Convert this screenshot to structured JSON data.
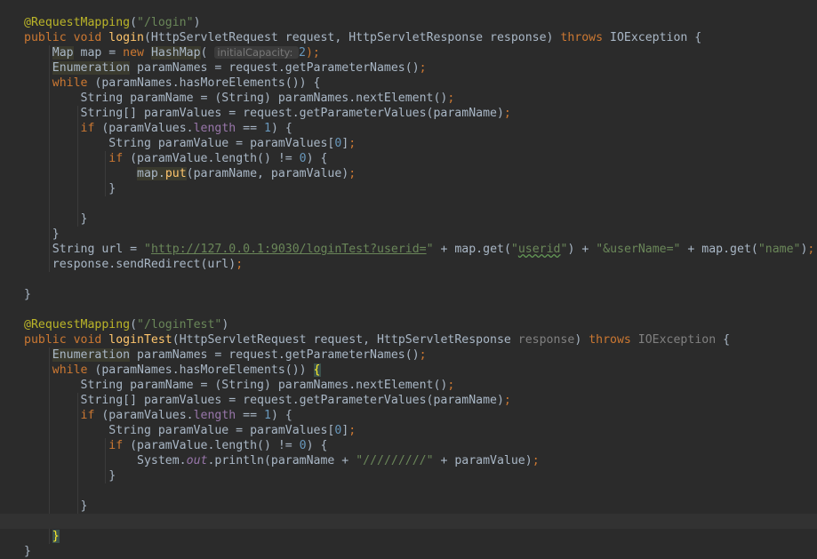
{
  "editor": {
    "lines": [
      {
        "tokens": [
          {
            "t": "@RequestMapping",
            "c": "ann"
          },
          {
            "t": "(",
            "c": "text"
          },
          {
            "t": "\"/login\"",
            "c": "str"
          },
          {
            "t": ")",
            "c": "text"
          }
        ]
      },
      {
        "tokens": [
          {
            "t": "public void ",
            "c": "kw"
          },
          {
            "t": "login",
            "c": "fn"
          },
          {
            "t": "(HttpServletRequest request, HttpServletResponse response) ",
            "c": "text"
          },
          {
            "t": "throws ",
            "c": "kw"
          },
          {
            "t": "IOException {",
            "c": "text"
          }
        ]
      },
      {
        "tokens": [
          {
            "t": "    ",
            "c": "text"
          },
          {
            "t": "Map",
            "c": "warn"
          },
          {
            "t": " map = ",
            "c": "text"
          },
          {
            "t": "new ",
            "c": "kw"
          },
          {
            "t": "HashMap",
            "c": "warn"
          },
          {
            "t": "( ",
            "c": "text"
          },
          {
            "t": "initialCapacity: ",
            "c": "hint"
          },
          {
            "t": "2",
            "c": "num"
          },
          {
            "t": ");",
            "c": "kw"
          }
        ]
      },
      {
        "tokens": [
          {
            "t": "    ",
            "c": "text"
          },
          {
            "t": "Enumeration",
            "c": "warn"
          },
          {
            "t": " paramNames = request.getParameterNames()",
            "c": "text"
          },
          {
            "t": ";",
            "c": "kw"
          }
        ]
      },
      {
        "tokens": [
          {
            "t": "    ",
            "c": "text"
          },
          {
            "t": "while ",
            "c": "kw"
          },
          {
            "t": "(paramNames.hasMoreElements()) {",
            "c": "text"
          }
        ]
      },
      {
        "tokens": [
          {
            "t": "        String paramName = (String) paramNames.nextElement()",
            "c": "text"
          },
          {
            "t": ";",
            "c": "kw"
          }
        ]
      },
      {
        "tokens": [
          {
            "t": "        String[] paramValues = request.getParameterValues(paramName)",
            "c": "text"
          },
          {
            "t": ";",
            "c": "kw"
          }
        ]
      },
      {
        "tokens": [
          {
            "t": "        ",
            "c": "text"
          },
          {
            "t": "if ",
            "c": "kw"
          },
          {
            "t": "(paramValues.",
            "c": "text"
          },
          {
            "t": "length ",
            "c": "field"
          },
          {
            "t": "== ",
            "c": "text"
          },
          {
            "t": "1",
            "c": "num"
          },
          {
            "t": ") {",
            "c": "text"
          }
        ]
      },
      {
        "tokens": [
          {
            "t": "            String paramValue = paramValues[",
            "c": "text"
          },
          {
            "t": "0",
            "c": "num"
          },
          {
            "t": "]",
            "c": "text"
          },
          {
            "t": ";",
            "c": "kw"
          }
        ]
      },
      {
        "tokens": [
          {
            "t": "            ",
            "c": "text"
          },
          {
            "t": "if ",
            "c": "kw"
          },
          {
            "t": "(paramValue.length() != ",
            "c": "text"
          },
          {
            "t": "0",
            "c": "num"
          },
          {
            "t": ") {",
            "c": "text"
          }
        ]
      },
      {
        "tokens": [
          {
            "t": "                ",
            "c": "text"
          },
          {
            "t": "map.",
            "c": "warn"
          },
          {
            "t": "put",
            "c": "warnfn"
          },
          {
            "t": "(paramName, paramValue)",
            "c": "text"
          },
          {
            "t": ";",
            "c": "kw"
          }
        ]
      },
      {
        "tokens": [
          {
            "t": "            }",
            "c": "text"
          }
        ]
      },
      {
        "tokens": []
      },
      {
        "tokens": [
          {
            "t": "        }",
            "c": "text"
          }
        ]
      },
      {
        "tokens": [
          {
            "t": "    }",
            "c": "text"
          }
        ]
      },
      {
        "tokens": [
          {
            "t": "    String url = ",
            "c": "text"
          },
          {
            "t": "\"",
            "c": "str"
          },
          {
            "t": "http://127.0.0.1:9030/loginTest?userid=",
            "c": "link"
          },
          {
            "t": "\"",
            "c": "str"
          },
          {
            "t": " + map.get(",
            "c": "text"
          },
          {
            "t": "\"",
            "c": "str"
          },
          {
            "t": "userid",
            "c": "typo"
          },
          {
            "t": "\"",
            "c": "str"
          },
          {
            "t": ") + ",
            "c": "text"
          },
          {
            "t": "\"&userName=\"",
            "c": "str"
          },
          {
            "t": " + map.get(",
            "c": "text"
          },
          {
            "t": "\"name\"",
            "c": "str"
          },
          {
            "t": ")",
            "c": "text"
          },
          {
            "t": ";",
            "c": "kw"
          }
        ]
      },
      {
        "tokens": [
          {
            "t": "    response.sendRedirect(url)",
            "c": "text"
          },
          {
            "t": ";",
            "c": "kw"
          }
        ]
      },
      {
        "tokens": []
      },
      {
        "tokens": [
          {
            "t": "}",
            "c": "text"
          }
        ]
      },
      {
        "tokens": []
      },
      {
        "tokens": [
          {
            "t": "@RequestMapping",
            "c": "ann"
          },
          {
            "t": "(",
            "c": "text"
          },
          {
            "t": "\"/loginTest\"",
            "c": "str"
          },
          {
            "t": ")",
            "c": "text"
          }
        ]
      },
      {
        "tokens": [
          {
            "t": "public void ",
            "c": "kw"
          },
          {
            "t": "loginTest",
            "c": "fn"
          },
          {
            "t": "(HttpServletRequest request, HttpServletResponse ",
            "c": "text"
          },
          {
            "t": "response",
            "c": "gray"
          },
          {
            "t": ") ",
            "c": "text"
          },
          {
            "t": "throws ",
            "c": "kw"
          },
          {
            "t": "IOException",
            "c": "gray"
          },
          {
            "t": " {",
            "c": "text"
          }
        ]
      },
      {
        "tokens": [
          {
            "t": "    ",
            "c": "text"
          },
          {
            "t": "Enumeration",
            "c": "warn"
          },
          {
            "t": " paramNames = request.getParameterNames()",
            "c": "text"
          },
          {
            "t": ";",
            "c": "kw"
          }
        ]
      },
      {
        "tokens": [
          {
            "t": "    ",
            "c": "text"
          },
          {
            "t": "while ",
            "c": "kw"
          },
          {
            "t": "(paramNames.hasMoreElements()) ",
            "c": "text"
          },
          {
            "t": "{",
            "c": "brace"
          }
        ]
      },
      {
        "tokens": [
          {
            "t": "        String paramName = (String) paramNames.nextElement()",
            "c": "text"
          },
          {
            "t": ";",
            "c": "kw"
          }
        ]
      },
      {
        "tokens": [
          {
            "t": "        String[] paramValues = request.getParameterValues(paramName)",
            "c": "text"
          },
          {
            "t": ";",
            "c": "kw"
          }
        ]
      },
      {
        "tokens": [
          {
            "t": "        ",
            "c": "text"
          },
          {
            "t": "if ",
            "c": "kw"
          },
          {
            "t": "(paramValues.",
            "c": "text"
          },
          {
            "t": "length ",
            "c": "field"
          },
          {
            "t": "== ",
            "c": "text"
          },
          {
            "t": "1",
            "c": "num"
          },
          {
            "t": ") {",
            "c": "text"
          }
        ]
      },
      {
        "tokens": [
          {
            "t": "            String paramValue = paramValues[",
            "c": "text"
          },
          {
            "t": "0",
            "c": "num"
          },
          {
            "t": "]",
            "c": "text"
          },
          {
            "t": ";",
            "c": "kw"
          }
        ]
      },
      {
        "tokens": [
          {
            "t": "            ",
            "c": "text"
          },
          {
            "t": "if ",
            "c": "kw"
          },
          {
            "t": "(paramValue.length() != ",
            "c": "text"
          },
          {
            "t": "0",
            "c": "num"
          },
          {
            "t": ") {",
            "c": "text"
          }
        ]
      },
      {
        "tokens": [
          {
            "t": "                System.",
            "c": "text"
          },
          {
            "t": "out",
            "c": "static"
          },
          {
            "t": ".println(paramName + ",
            "c": "text"
          },
          {
            "t": "\"/////////\"",
            "c": "str"
          },
          {
            "t": " + paramValue)",
            "c": "text"
          },
          {
            "t": ";",
            "c": "kw"
          }
        ]
      },
      {
        "tokens": [
          {
            "t": "            }",
            "c": "text"
          }
        ]
      },
      {
        "tokens": []
      },
      {
        "tokens": [
          {
            "t": "        }",
            "c": "text"
          }
        ]
      },
      {
        "tokens": [],
        "caret": true
      },
      {
        "tokens": [
          {
            "t": "    ",
            "c": "text"
          },
          {
            "t": "}",
            "c": "brace"
          }
        ]
      },
      {
        "tokens": [
          {
            "t": "}",
            "c": "text"
          }
        ]
      }
    ]
  }
}
